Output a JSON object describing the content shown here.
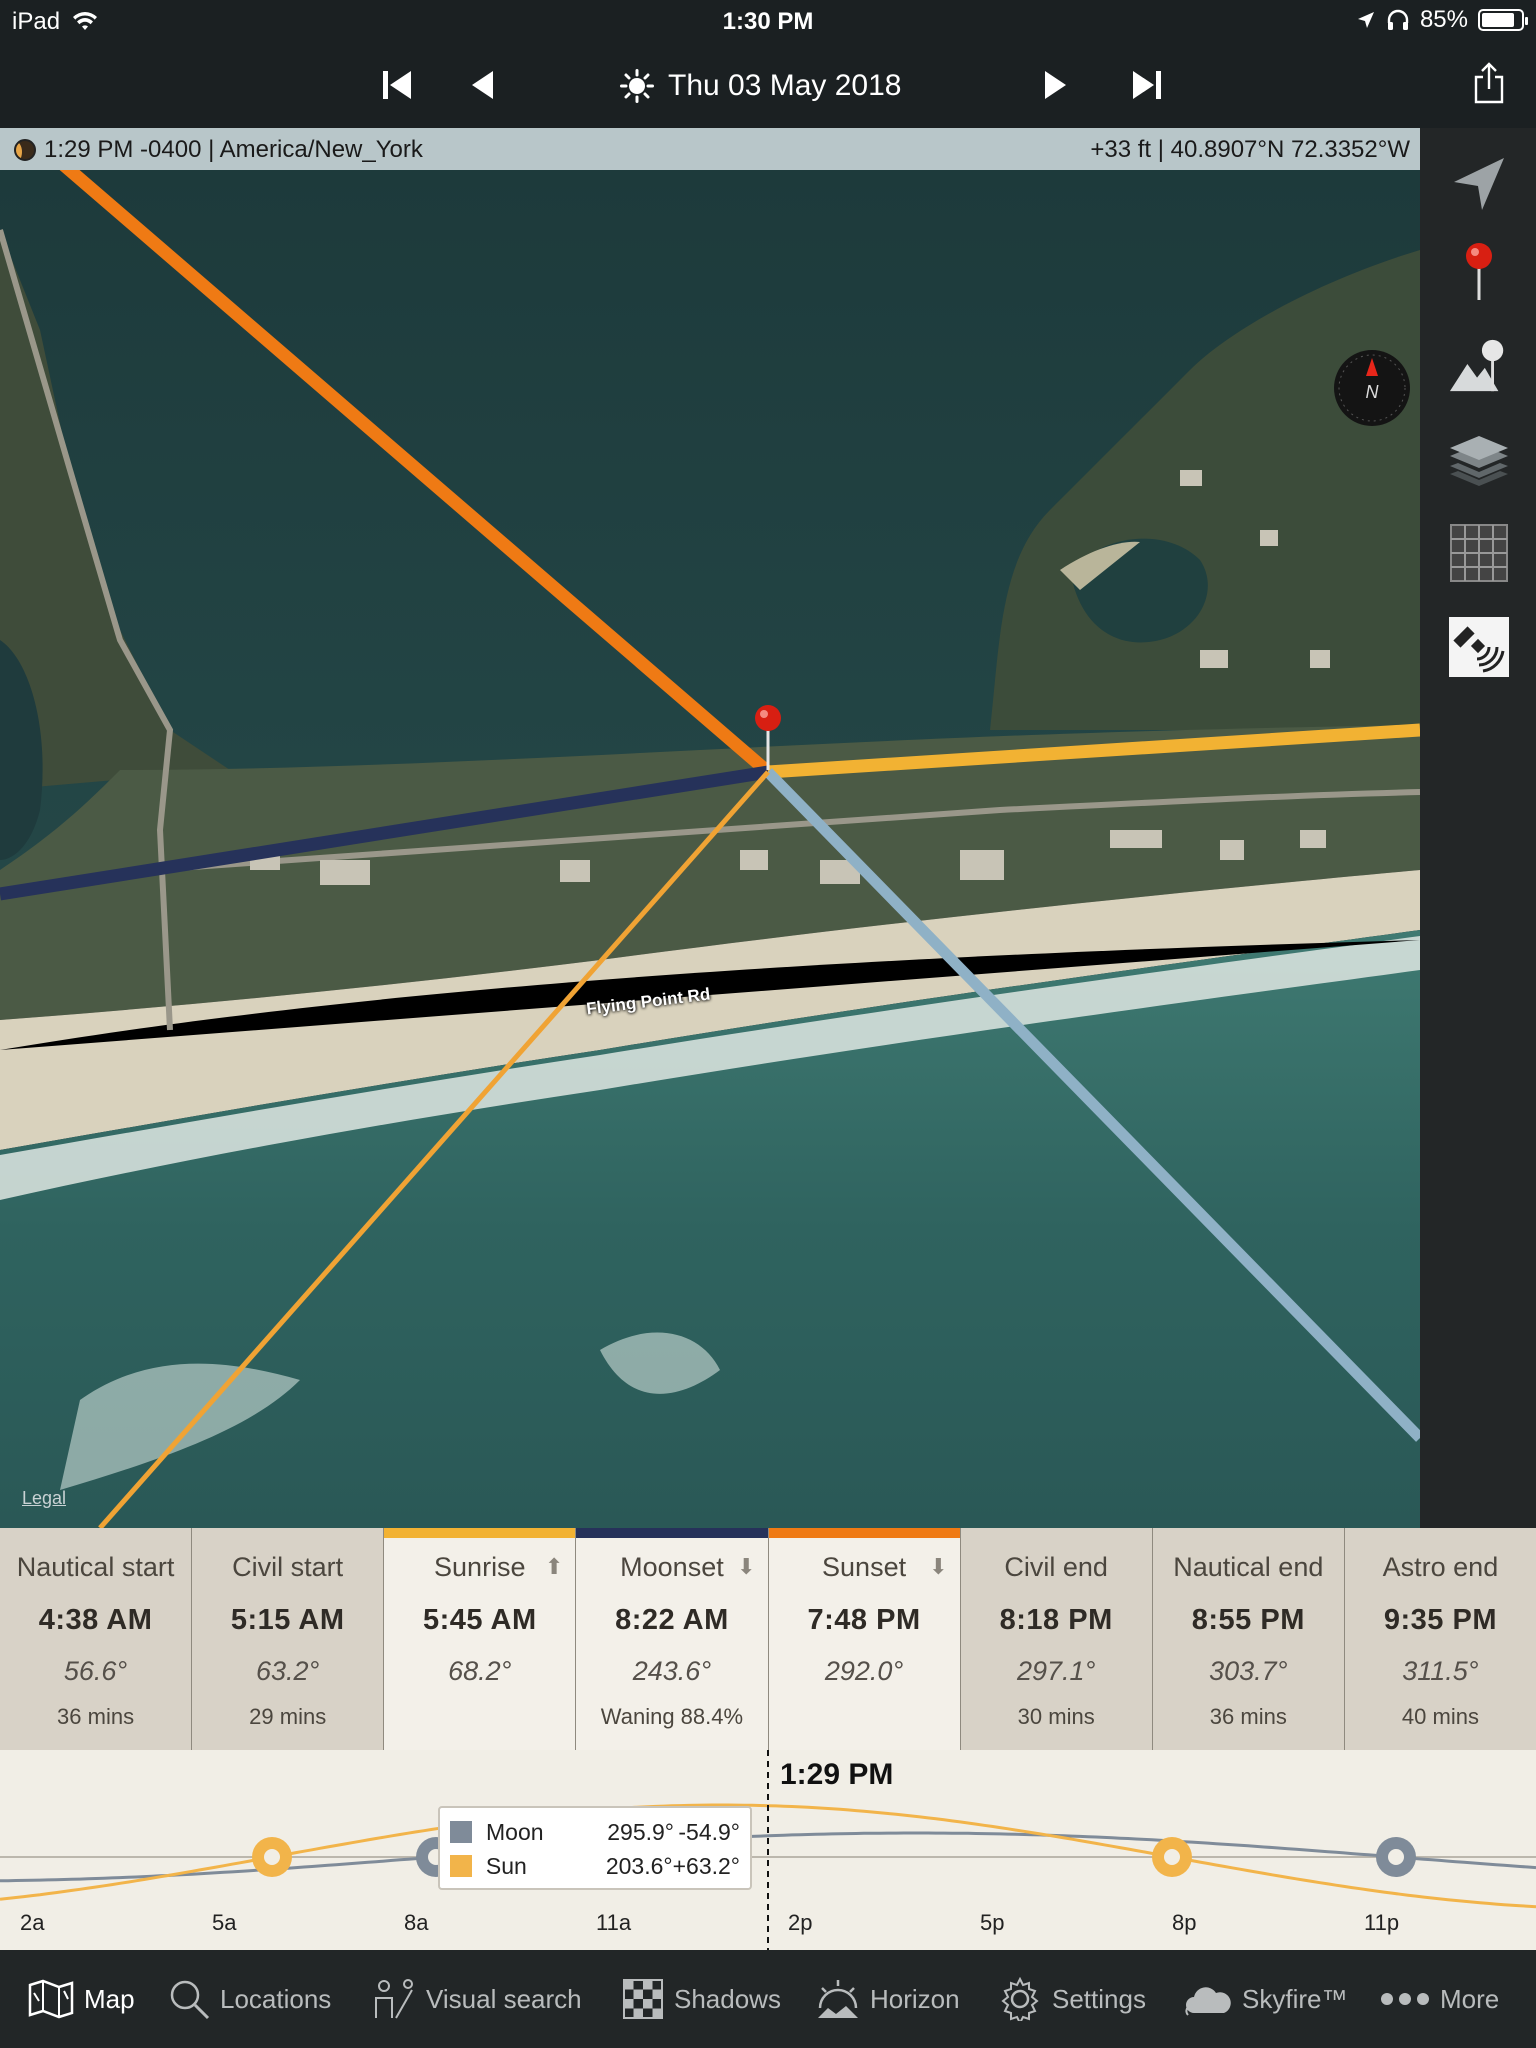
{
  "status_bar": {
    "device": "iPad",
    "time": "1:30 PM",
    "battery": "85%",
    "battery_level": 0.85
  },
  "nav": {
    "date": "Thu 03 May 2018"
  },
  "info_strip": {
    "local_time": "1:29 PM -0400 | America/New_York",
    "elevation_coords": "+33 ft | 40.8907°N 72.3352°W"
  },
  "map": {
    "road_label": "Flying Point Rd",
    "legal": "Legal",
    "compass_letter": "N"
  },
  "events": [
    {
      "name": "Nautical start",
      "time": "4:38 AM",
      "azimuth": "56.6°",
      "sub": "36 mins",
      "style": "dark",
      "bar_color": ""
    },
    {
      "name": "Civil start",
      "time": "5:15 AM",
      "azimuth": "63.2°",
      "sub": "29 mins",
      "style": "dark",
      "bar_color": ""
    },
    {
      "name": "Sunrise",
      "time": "5:45 AM",
      "azimuth": "68.2°",
      "sub": "",
      "style": "light",
      "bar_color": "#f2b233",
      "arrow": "up"
    },
    {
      "name": "Moonset",
      "time": "8:22 AM",
      "azimuth": "243.6°",
      "sub": "Waning 88.4%",
      "style": "light",
      "bar_color": "#26325a",
      "arrow": "down"
    },
    {
      "name": "Sunset",
      "time": "7:48 PM",
      "azimuth": "292.0°",
      "sub": "",
      "style": "light",
      "bar_color": "#ef7a14",
      "arrow": "down"
    },
    {
      "name": "Civil end",
      "time": "8:18 PM",
      "azimuth": "297.1°",
      "sub": "30 mins",
      "style": "dark",
      "bar_color": ""
    },
    {
      "name": "Nautical end",
      "time": "8:55 PM",
      "azimuth": "303.7°",
      "sub": "36 mins",
      "style": "dark",
      "bar_color": ""
    },
    {
      "name": "Astro end",
      "time": "9:35 PM",
      "azimuth": "311.5°",
      "sub": "40 mins",
      "style": "dark",
      "bar_color": ""
    }
  ],
  "timeline": {
    "now_label": "1:29 PM",
    "hours": [
      "2a",
      "5a",
      "8a",
      "11a",
      "2p",
      "5p",
      "8p",
      "11p"
    ],
    "tooltip": {
      "moon": {
        "name": "Moon",
        "azimuth": "295.9°",
        "elevation": "-54.9°",
        "color": "#7f8b99"
      },
      "sun": {
        "name": "Sun",
        "azimuth": "203.6°",
        "elevation": "+63.2°",
        "color": "#f2b44a"
      }
    }
  },
  "tabs": [
    {
      "label": "Map",
      "icon": "map-icon",
      "active": true
    },
    {
      "label": "Locations",
      "icon": "search-icon",
      "active": false
    },
    {
      "label": "Visual search",
      "icon": "visual-search-icon",
      "active": false
    },
    {
      "label": "Shadows",
      "icon": "shadows-icon",
      "active": false
    },
    {
      "label": "Horizon",
      "icon": "horizon-icon",
      "active": false
    },
    {
      "label": "Settings",
      "icon": "gear-icon",
      "active": false
    },
    {
      "label": "Skyfire™",
      "icon": "cloud-icon",
      "active": false
    },
    {
      "label": "More",
      "icon": "more-dots-icon",
      "active": false
    }
  ],
  "colors": {
    "sunrise_line": "#f2b233",
    "sunset_line": "#ef7a14",
    "moonrise_line": "#8fb1c6",
    "moonset_line": "#26325a",
    "sun_now_line": "#f0a334",
    "pin": "#d81f12"
  }
}
